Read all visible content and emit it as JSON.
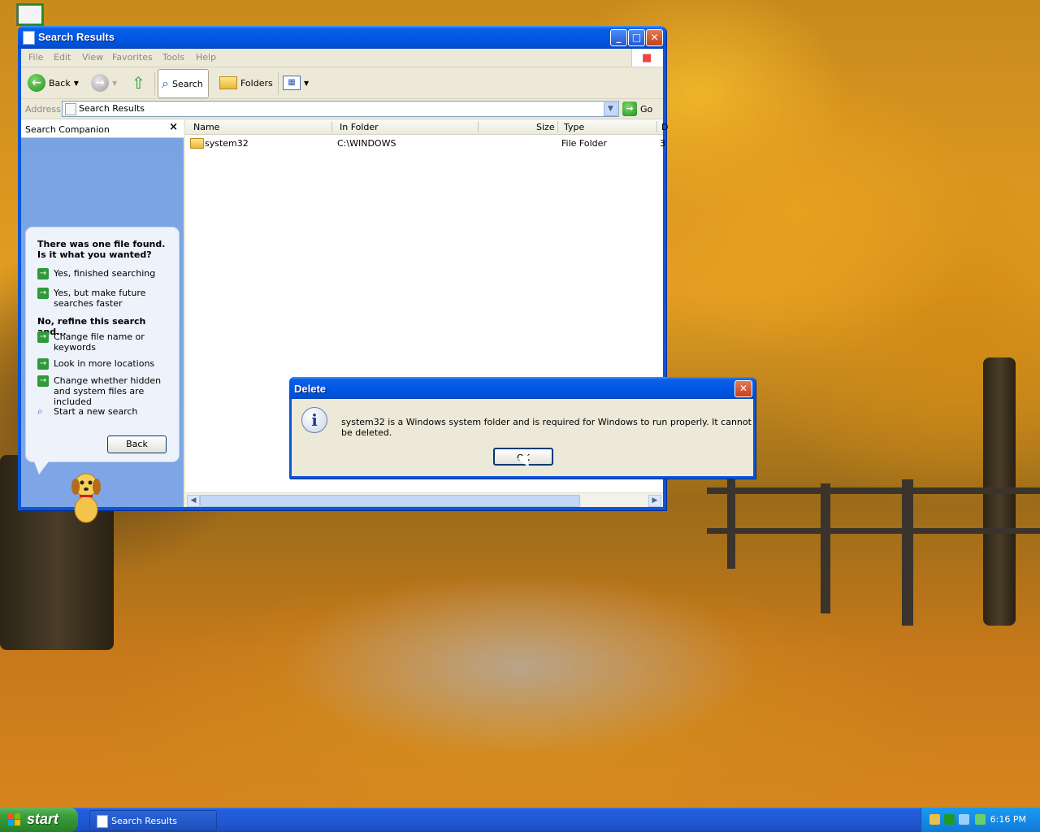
{
  "window": {
    "title": "Search Results",
    "menu": [
      "File",
      "Edit",
      "View",
      "Favorites",
      "Tools",
      "Help"
    ],
    "toolbar": {
      "back": "Back",
      "search": "Search",
      "folders": "Folders"
    },
    "address": {
      "label": "Address",
      "value": "Search Results",
      "go": "Go"
    }
  },
  "companion": {
    "title": "Search Companion",
    "question": "There was one file found.  Is it what you wanted?",
    "yes_options": [
      "Yes, finished searching",
      "Yes, but make future searches faster"
    ],
    "refine_heading": "No, refine this search and...",
    "refine_options": [
      "Change file name or keywords",
      "Look in more locations",
      "Change whether hidden and system files are included"
    ],
    "new_search": "Start a new search",
    "back_button": "Back"
  },
  "results": {
    "columns": [
      "Name",
      "In Folder",
      "Size",
      "Type",
      "D"
    ],
    "rows": [
      {
        "name": "system32",
        "folder": "C:\\WINDOWS",
        "size": "",
        "type": "File Folder",
        "extra": "3"
      }
    ]
  },
  "dialog": {
    "title": "Delete",
    "message": "system32 is a Windows system folder and is required for Windows to run properly. It cannot be deleted.",
    "ok": "OK"
  },
  "taskbar": {
    "start": "start",
    "task": "Search Results",
    "clock": "6:16 PM"
  },
  "colors": {
    "title_blue": "#0058e6",
    "start_green": "#3c9f3c",
    "tray_blue": "#1079d8"
  }
}
